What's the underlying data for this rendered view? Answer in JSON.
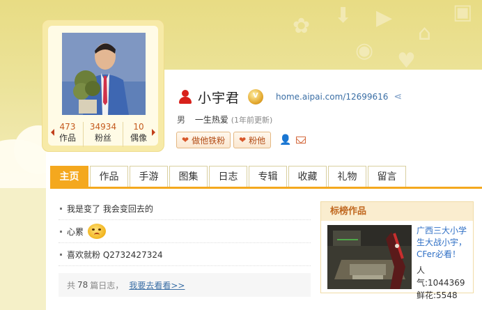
{
  "profile": {
    "username": "小宇君",
    "home_link": "home.aipai.com/12699616",
    "gender": "男",
    "signature": "一生热爱",
    "updated": "(1年前更新)",
    "stats": [
      {
        "num": "473",
        "label": "作品"
      },
      {
        "num": "34934",
        "label": "粉丝"
      },
      {
        "num": "10",
        "label": "偶像"
      }
    ],
    "buttons": {
      "iron_fan": "做他铁粉",
      "follow": "粉他"
    }
  },
  "tabs": [
    {
      "label": "主页",
      "active": true
    },
    {
      "label": "作品"
    },
    {
      "label": "手游"
    },
    {
      "label": "图集"
    },
    {
      "label": "日志"
    },
    {
      "label": "专辑"
    },
    {
      "label": "收藏"
    },
    {
      "label": "礼物"
    },
    {
      "label": "留言"
    }
  ],
  "posts": [
    {
      "text": "我是变了 我会变回去的"
    },
    {
      "text": "心累"
    },
    {
      "text": "喜欢就粉 Q2732427324"
    }
  ],
  "post_footer": {
    "prefix": "共",
    "count": "78",
    "suffix": "篇日志，",
    "more": "我要去看看>>"
  },
  "featured": {
    "title": "标榜作品",
    "video_title": "广西三大小学生大战小宇，CFer必看！",
    "popularity": "人气:1044369",
    "flowers": "鲜花:5548"
  },
  "colors": {
    "accent": "#f4a81e",
    "link": "#3a6ea5",
    "stat_number": "#c45a1e"
  }
}
